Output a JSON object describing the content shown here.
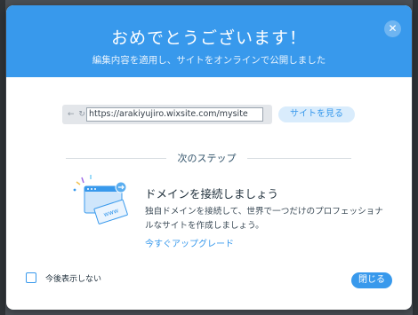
{
  "modal": {
    "title": "おめでとうございます！",
    "subtitle": "編集内容を適用し、サイトをオンラインで公開しました",
    "close_icon": "✕"
  },
  "url_bar": {
    "nav_icons": "← ↻",
    "url": "https://arakiyujiro.wixsite.com/mysite"
  },
  "view_site_button": "サイトを見る",
  "next_steps": {
    "label": "次のステップ",
    "illustration_text": "www",
    "title": "ドメインを接続しましょう",
    "description": "独自ドメインを接続して、世界で一つだけのプロフェッショナルなサイトを作成しましょう。",
    "upgrade_link": "今すぐアップグレード"
  },
  "footer": {
    "dont_show_label": "今後表示しない",
    "close_button": "閉じる"
  },
  "colors": {
    "accent": "#3899ec",
    "header_bg": "#3899ec",
    "backdrop": "#4a4f55"
  }
}
